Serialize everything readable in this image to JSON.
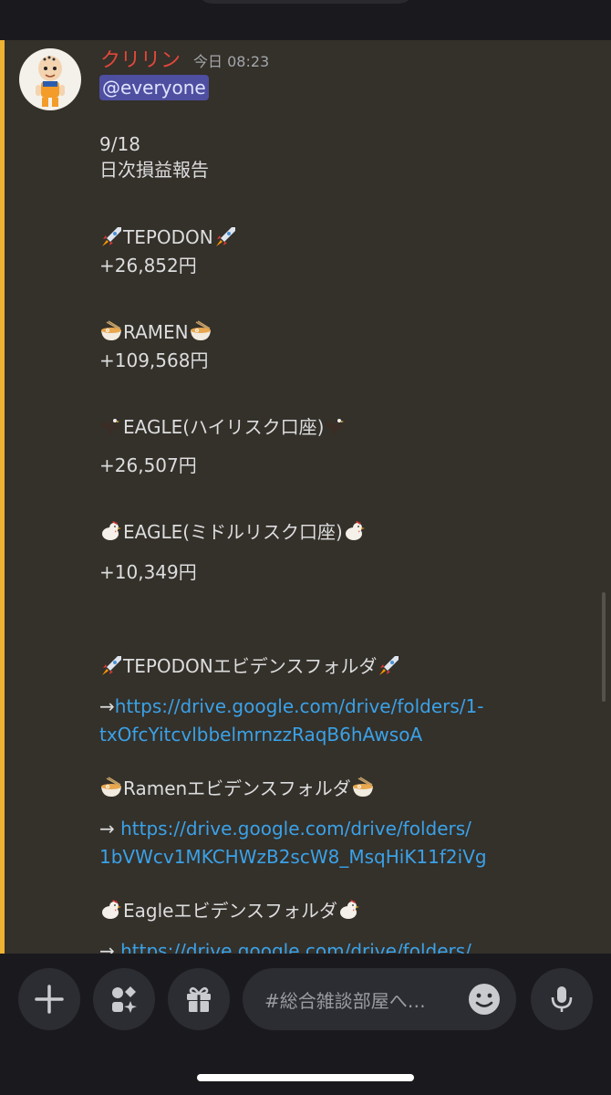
{
  "message": {
    "username": "クリリン",
    "timestamp": "今日 08:23",
    "mention": "@everyone",
    "date": "9/18",
    "report_title": "日次損益報告",
    "tepodon_label": "TEPODON",
    "tepodon_value": "+26,852円",
    "ramen_label": "RAMEN",
    "ramen_value": "+109,568円",
    "eagle_high_label": "EAGLE(ハイリスク口座)",
    "eagle_high_value": "+26,507円",
    "eagle_mid_label": "EAGLE(ミドルリスク口座)",
    "eagle_mid_value": "+10,349円",
    "tepodon_folder_label": "TEPODONエビデンスフォルダ",
    "tepodon_arrow": "→",
    "tepodon_link_1": "https://drive.google.com/drive/folders/1-",
    "tepodon_link_2": "txOfcYitcvlbbelmrnzzRaqB6hAwsoA",
    "ramen_folder_label": "Ramenエビデンスフォルダ",
    "ramen_arrow": "→ ",
    "ramen_link_1": "https://drive.google.com/drive/folders/",
    "ramen_link_2": "1bVWcv1MKCHWzB2scW8_MsqHiK11f2iVg",
    "eagle_folder_label": "Eagleエビデンスフォルダ",
    "eagle_arrow": "→ ",
    "eagle_link_1": "https://drive.google.com/drive/folders/"
  },
  "composer": {
    "placeholder": "#総合雑談部屋へ…"
  },
  "icons": [
    "rocket-icon",
    "ramen-bowl-icon",
    "eagle-icon",
    "chicken-icon",
    "plus-icon",
    "apps-icon",
    "gift-icon",
    "emoji-icon",
    "microphone-icon"
  ],
  "colors": {
    "username": "#e0483a",
    "link": "#3aa2e8",
    "mention_bg": "#4e4fa0",
    "mention_bar": "#f0b232"
  }
}
